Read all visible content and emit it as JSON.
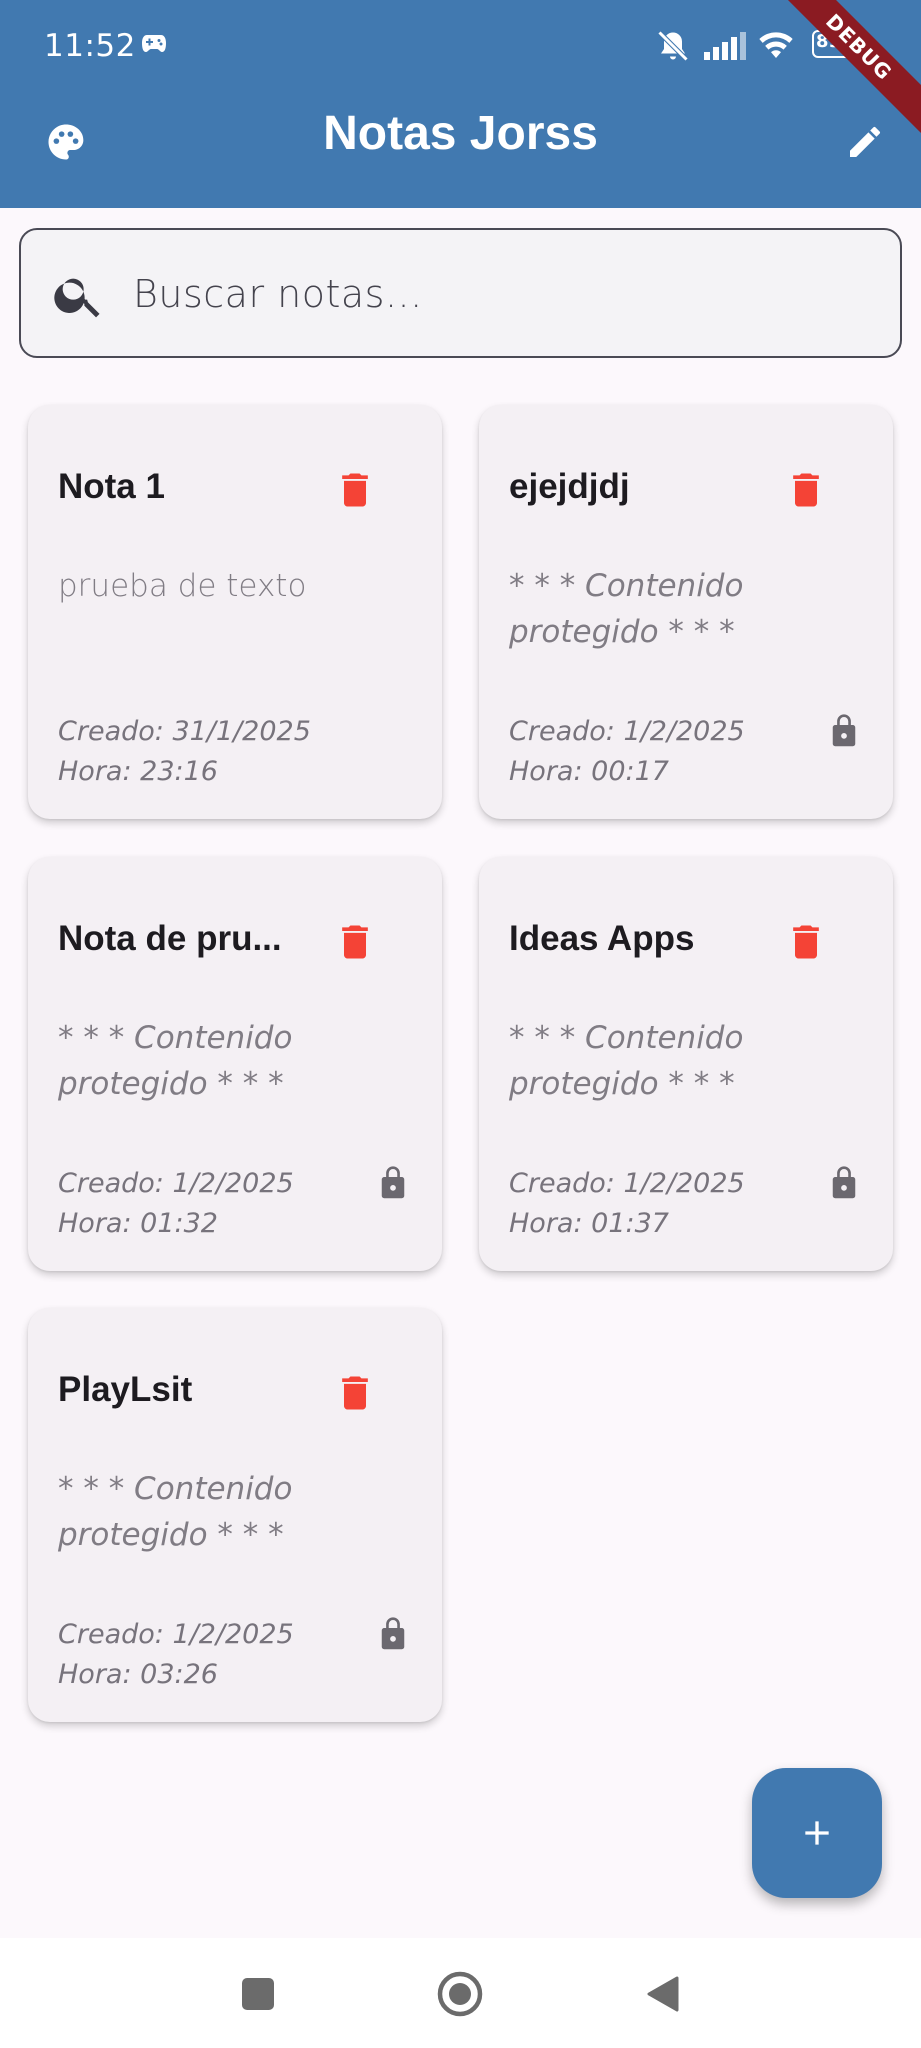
{
  "status_bar": {
    "time": "11:52",
    "battery": "89"
  },
  "app_bar": {
    "title": "Notas Jorss",
    "debug_label": "DEBUG",
    "accent_color": "#4179b0"
  },
  "search": {
    "placeholder": "Buscar notas...",
    "value": ""
  },
  "notes": [
    {
      "title": "Nota 1",
      "content": "prueba de texto",
      "created": "Creado: 31/1/2025",
      "time": "Hora: 23:16",
      "locked": false
    },
    {
      "title": "ejejdjdj",
      "content": "* * * Contenido protegido * * *",
      "created": "Creado: 1/2/2025",
      "time": "Hora: 00:17",
      "locked": true
    },
    {
      "title": "Nota de pru...",
      "content": "* * * Contenido protegido * * *",
      "created": "Creado: 1/2/2025",
      "time": "Hora: 01:32",
      "locked": true
    },
    {
      "title": "Ideas Apps",
      "content": "* * * Contenido protegido * * *",
      "created": "Creado: 1/2/2025",
      "time": "Hora: 01:37",
      "locked": true
    },
    {
      "title": "PlayLsit",
      "content": "* * * Contenido protegido * * *",
      "created": "Creado: 1/2/2025",
      "time": "Hora: 03:26",
      "locked": true
    }
  ],
  "fab": {
    "icon": "plus-icon"
  },
  "colors": {
    "delete": "#f44336",
    "lock": "#6b686f"
  }
}
